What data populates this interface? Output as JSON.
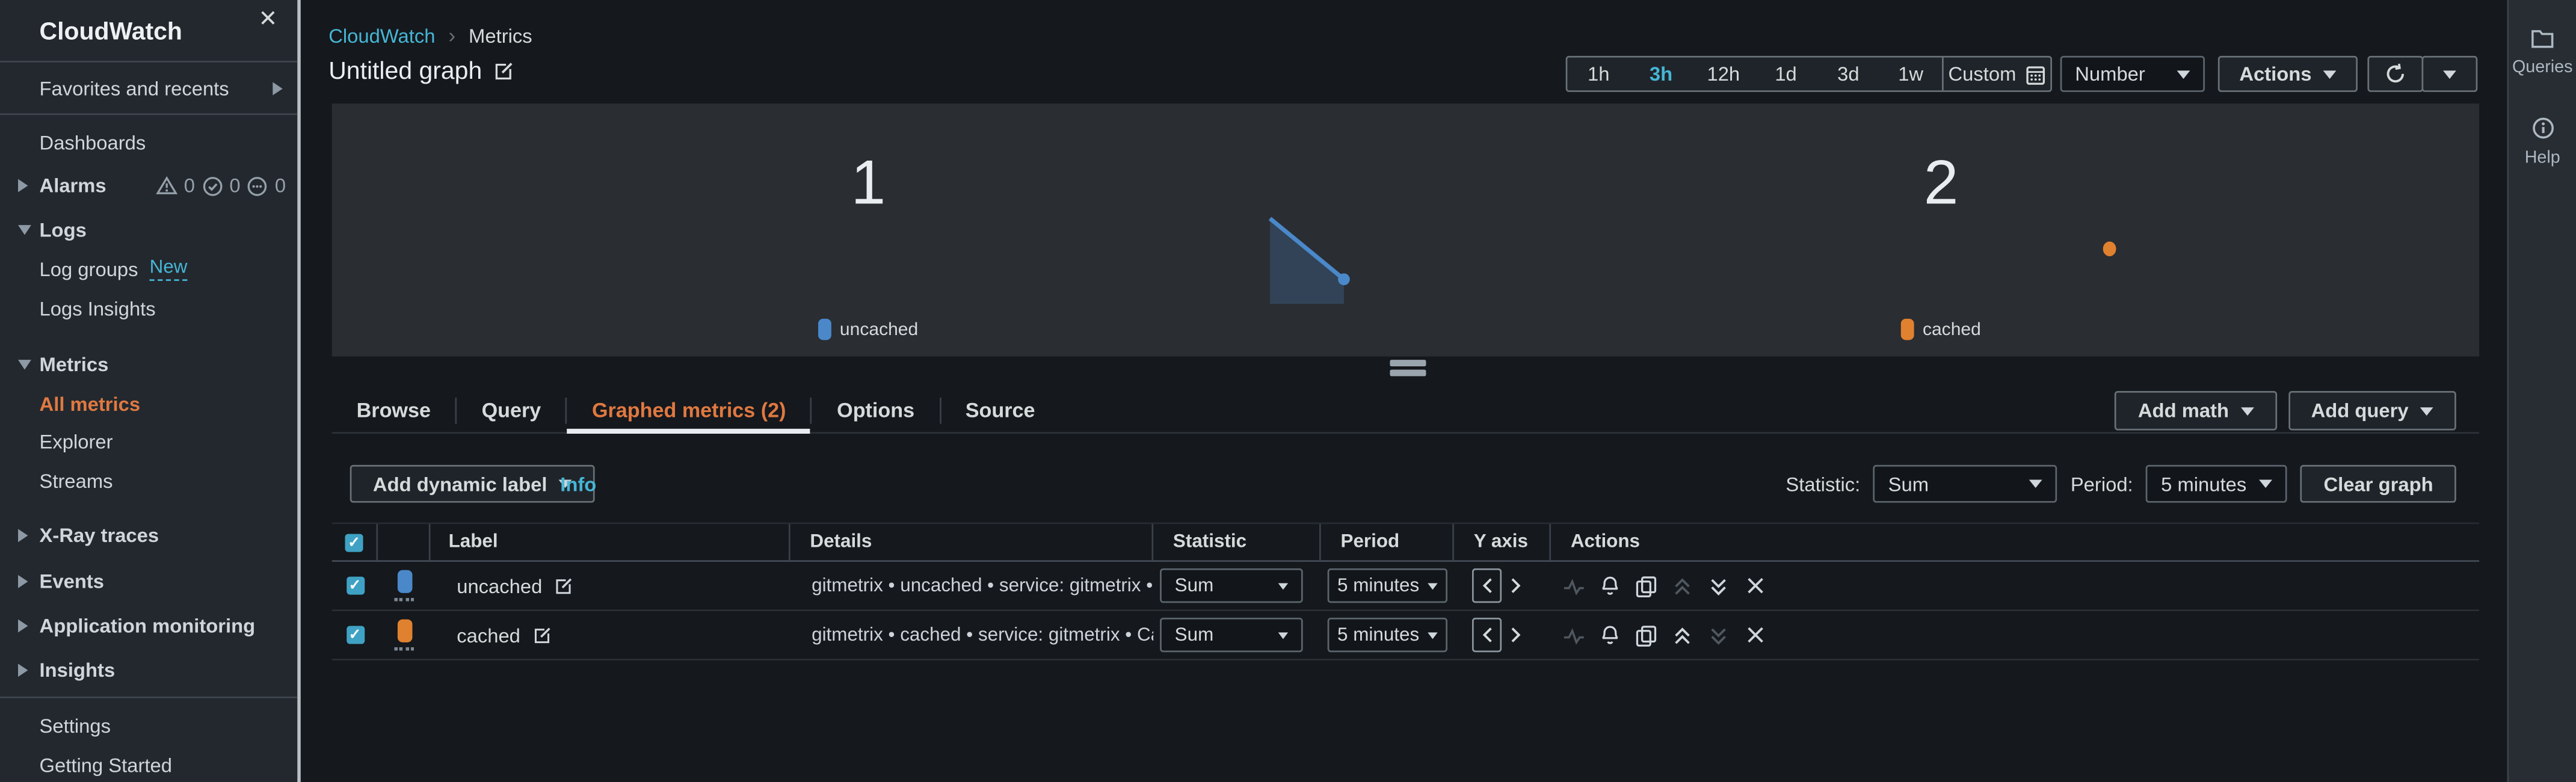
{
  "colors": {
    "accent_blue": "#46b6d6",
    "accent_orange": "#e07941",
    "series_uncached": "#4a88c9",
    "series_cached": "#e0812f",
    "panel_bg": "#2a2d32",
    "page_bg": "#15181c"
  },
  "sidebar": {
    "title": "CloudWatch",
    "favorites_label": "Favorites and recents",
    "items": {
      "dashboards": "Dashboards",
      "alarms": "Alarms",
      "logs": "Logs",
      "log_groups": "Log groups",
      "log_groups_badge": "New",
      "logs_insights": "Logs Insights",
      "metrics": "Metrics",
      "all_metrics": "All metrics",
      "explorer": "Explorer",
      "streams": "Streams",
      "xray_traces": "X-Ray traces",
      "events": "Events",
      "application_monitoring": "Application monitoring",
      "insights": "Insights",
      "settings": "Settings",
      "getting_started": "Getting Started"
    },
    "alarm_counts": {
      "in_alarm": "0",
      "ok": "0",
      "insufficient_data": "0"
    }
  },
  "breadcrumb": {
    "root": "CloudWatch",
    "separator": "›",
    "current": "Metrics"
  },
  "header": {
    "title": "Untitled graph"
  },
  "time_controls": {
    "ranges": {
      "h1": "1h",
      "h3": "3h",
      "h12": "12h",
      "d1": "1d",
      "d3": "3d",
      "w1": "1w"
    },
    "selected": "3h",
    "custom": "Custom",
    "view_mode": "Number",
    "actions": "Actions"
  },
  "graph": {
    "left": {
      "value": "1",
      "legend": "uncached"
    },
    "right": {
      "value": "2",
      "legend": "cached"
    }
  },
  "chart_data": {
    "type": "number",
    "title": "Untitled graph",
    "view": "Number",
    "time_range_selected": "3h",
    "statistic": "Sum",
    "period": "5 minutes",
    "series": [
      {
        "label": "uncached",
        "value": 1,
        "color": "#4a88c9",
        "sparkline": "short descending line segment ending in a dot, right of panel center"
      },
      {
        "label": "cached",
        "value": 2,
        "color": "#e0812f",
        "sparkline": "single point, right of panel center"
      }
    ],
    "legend_position": "bottom-center of each half panel"
  },
  "tabs": {
    "browse": "Browse",
    "query": "Query",
    "graphed": "Graphed metrics (2)",
    "options": "Options",
    "source": "Source",
    "active": "Graphed metrics (2)"
  },
  "graph_buttons": {
    "add_math": "Add math",
    "add_query": "Add query"
  },
  "toolbar": {
    "add_dynamic_label": "Add dynamic label",
    "info": "Info",
    "statistic_label": "Statistic:",
    "statistic_value": "Sum",
    "period_label": "Period:",
    "period_value": "5 minutes",
    "clear_graph": "Clear graph"
  },
  "table": {
    "headers": {
      "label": "Label",
      "details": "Details",
      "statistic": "Statistic",
      "period": "Period",
      "yaxis": "Y axis",
      "actions": "Actions"
    },
    "rows": [
      {
        "checked": true,
        "color": "#4a88c9",
        "label": "uncached",
        "details": "gitmetrix • uncached • service: gitmetrix • Cac",
        "statistic": "Sum",
        "period": "5 minutes",
        "y_axis_selected": "left",
        "move_up_enabled": false,
        "move_down_enabled": true
      },
      {
        "checked": true,
        "color": "#e0812f",
        "label": "cached",
        "details": "gitmetrix • cached • service: gitmetrix • Cache",
        "statistic": "Sum",
        "period": "5 minutes",
        "y_axis_selected": "left",
        "move_up_enabled": true,
        "move_down_enabled": false
      }
    ]
  },
  "side_panel": {
    "queries": "Queries",
    "help": "Help"
  }
}
